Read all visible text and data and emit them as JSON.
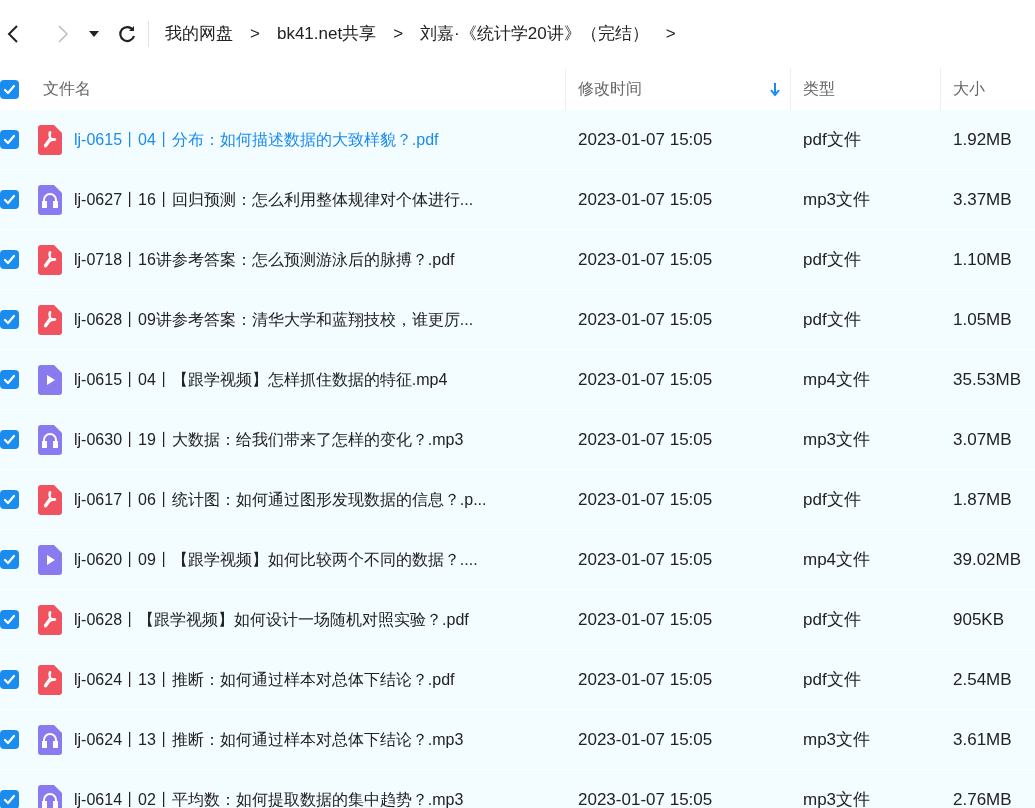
{
  "nav": {
    "back_disabled": false,
    "forward_disabled": true
  },
  "breadcrumb": [
    {
      "label": "我的网盘",
      "separator": ">"
    },
    {
      "label": "bk41.net共享",
      "separator": ">"
    },
    {
      "label": "刘嘉·《统计学20讲》（完结）",
      "separator": ">"
    }
  ],
  "table": {
    "select_all_checked": true,
    "columns": [
      {
        "label": "文件名",
        "sorted": false
      },
      {
        "label": "修改时间",
        "sorted": true
      },
      {
        "label": "类型",
        "sorted": false
      },
      {
        "label": "大小",
        "sorted": false
      }
    ],
    "rows": [
      {
        "kind": "pdf",
        "checked": true,
        "highlighted": true,
        "name": "lj-0615丨04丨分布：如何描述数据的大致样貌？.pdf",
        "modified": "2023-01-07 15:05",
        "type": "pdf文件",
        "size": "1.92MB"
      },
      {
        "kind": "audio",
        "checked": true,
        "highlighted": false,
        "name": "lj-0627丨16丨回归预测：怎么利用整体规律对个体进行...",
        "modified": "2023-01-07 15:05",
        "type": "mp3文件",
        "size": "3.37MB"
      },
      {
        "kind": "pdf",
        "checked": true,
        "highlighted": false,
        "name": "lj-0718丨16讲参考答案：怎么预测游泳后的脉搏？.pdf",
        "modified": "2023-01-07 15:05",
        "type": "pdf文件",
        "size": "1.10MB"
      },
      {
        "kind": "pdf",
        "checked": true,
        "highlighted": false,
        "name": "lj-0628丨09讲参考答案：清华大学和蓝翔技校，谁更厉...",
        "modified": "2023-01-07 15:05",
        "type": "pdf文件",
        "size": "1.05MB"
      },
      {
        "kind": "video",
        "checked": true,
        "highlighted": false,
        "name": "lj-0615丨04丨【跟学视频】怎样抓住数据的特征.mp4",
        "modified": "2023-01-07 15:05",
        "type": "mp4文件",
        "size": "35.53MB"
      },
      {
        "kind": "audio",
        "checked": true,
        "highlighted": false,
        "name": "lj-0630丨19丨大数据：给我们带来了怎样的变化？.mp3",
        "modified": "2023-01-07 15:05",
        "type": "mp3文件",
        "size": "3.07MB"
      },
      {
        "kind": "pdf",
        "checked": true,
        "highlighted": false,
        "name": "lj-0617丨06丨统计图：如何通过图形发现数据的信息？.p...",
        "modified": "2023-01-07 15:05",
        "type": "pdf文件",
        "size": "1.87MB"
      },
      {
        "kind": "video",
        "checked": true,
        "highlighted": false,
        "name": "lj-0620丨09丨【跟学视频】如何比较两个不同的数据？....",
        "modified": "2023-01-07 15:05",
        "type": "mp4文件",
        "size": "39.02MB"
      },
      {
        "kind": "pdf",
        "checked": true,
        "highlighted": false,
        "name": "lj-0628丨【跟学视频】如何设计一场随机对照实验？.pdf",
        "modified": "2023-01-07 15:05",
        "type": "pdf文件",
        "size": "905KB"
      },
      {
        "kind": "pdf",
        "checked": true,
        "highlighted": false,
        "name": "lj-0624丨13丨推断：如何通过样本对总体下结论？.pdf",
        "modified": "2023-01-07 15:05",
        "type": "pdf文件",
        "size": "2.54MB"
      },
      {
        "kind": "audio",
        "checked": true,
        "highlighted": false,
        "name": "lj-0624丨13丨推断：如何通过样本对总体下结论？.mp3",
        "modified": "2023-01-07 15:05",
        "type": "mp3文件",
        "size": "3.61MB"
      },
      {
        "kind": "audio",
        "checked": true,
        "highlighted": false,
        "name": "lj-0614丨02丨平均数：如何提取数据的集中趋势？.mp3",
        "modified": "2023-01-07 15:05",
        "type": "mp3文件",
        "size": "2.76MB"
      }
    ]
  }
}
